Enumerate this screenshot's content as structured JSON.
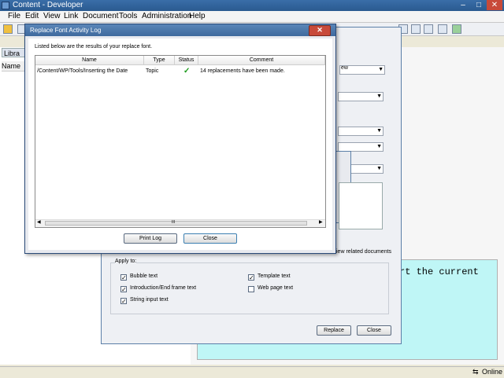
{
  "window": {
    "title": "Content - Developer"
  },
  "menu": [
    "File",
    "Edit",
    "View",
    "Link",
    "Document",
    "Tools",
    "Administration",
    "Help"
  ],
  "left_panel": {
    "library_tab": "Libra",
    "name_header": "Name"
  },
  "code_text": "rt the current",
  "status": {
    "text": "Online"
  },
  "background_dialog": {
    "related_link": "iew related documents",
    "apply_to_label": "Apply to:",
    "checkboxes": [
      {
        "label": "Bubble text",
        "checked": true
      },
      {
        "label": "Introduction/End frame text",
        "checked": true
      },
      {
        "label": "String input text",
        "checked": true
      },
      {
        "label": "Template text",
        "checked": true
      },
      {
        "label": "Web page text",
        "checked": false
      }
    ],
    "replace_button": "Replace",
    "close_button": "Close",
    "combo_partial": "ew"
  },
  "dialog": {
    "title": "Replace Font Activity Log",
    "close_glyph": "✕",
    "intro": "Listed below are the results of your replace font.",
    "columns": [
      "Name",
      "Type",
      "Status",
      "Comment"
    ],
    "rows": [
      {
        "name": "/Content/WP/Tools/Inserting the Date",
        "type": "Topic",
        "status": "✓",
        "comment": "14 replacements have been made."
      }
    ],
    "scroll_grip": "III",
    "print_button": "Print Log",
    "close_button": "Close"
  },
  "colors": {
    "status_ok": "#1a9a1a",
    "code_bg": "#bff6f6",
    "title_bar": "#3f6a9e"
  }
}
